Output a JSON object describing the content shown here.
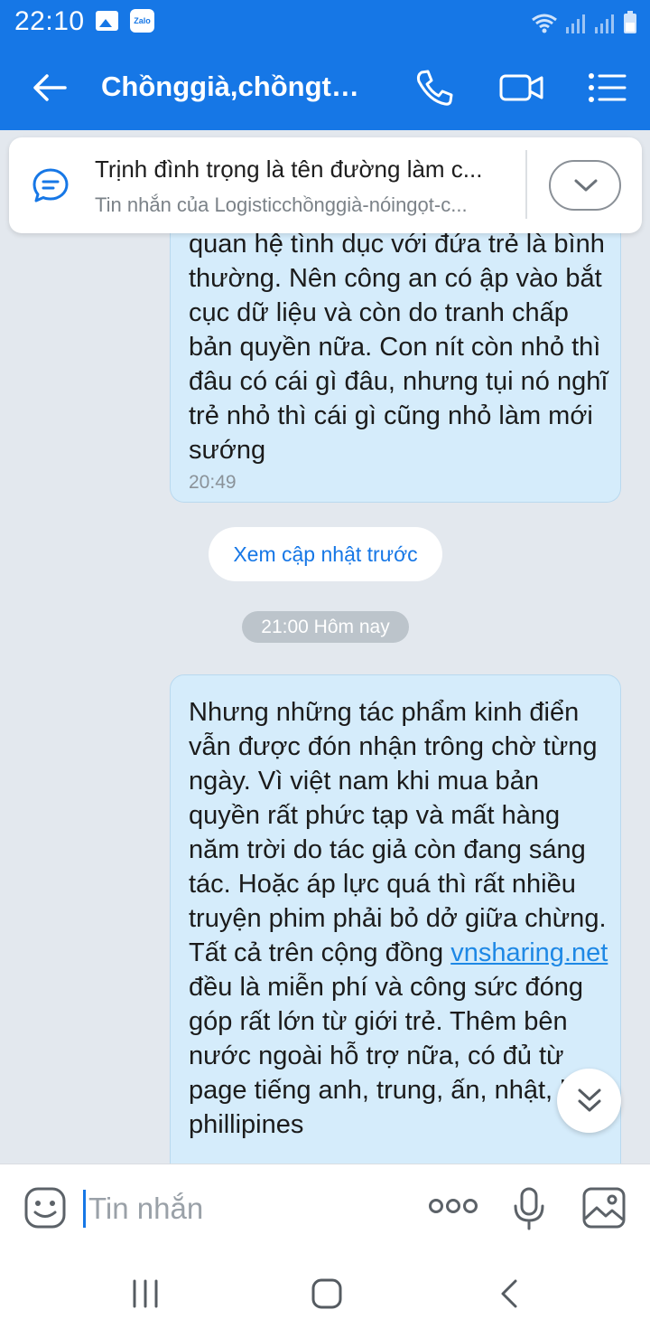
{
  "status_bar": {
    "time": "22:10",
    "notification_icons": [
      "gallery-icon",
      "zalo-icon"
    ],
    "system_icons": [
      "wifi-icon",
      "signal-icon",
      "signal-icon",
      "battery-icon"
    ],
    "zalo_label": "Zalo"
  },
  "header": {
    "title": "Chồnggià,chồngtr...",
    "actions": [
      "back-arrow-icon",
      "phone-icon",
      "video-call-icon",
      "menu-list-icon"
    ]
  },
  "pinned": {
    "title": "Trịnh đình trọng là tên đường làm c...",
    "subtitle": "Tin nhắn của Logisticchồnggià-nóingọt-c..."
  },
  "messages": [
    {
      "text": "quan hệ tình dục với đứa trẻ là bình thường. Nên công an có ập vào bắt cục dữ liệu và còn do tranh chấp bản quyền nữa. Con nít còn nhỏ thì đâu có cái gì đâu, nhưng tụi nó nghĩ trẻ nhỏ thì cái gì cũng nhỏ làm mới sướng",
      "time": "20:49"
    },
    {
      "text_before": "Nhưng những tác phẩm kinh điển vẫn được đón nhận trông chờ từng ngày. Vì việt nam khi mua bản quyền rất phức tạp và mất hàng năm trời do tác giả còn đang sáng tác. Hoặc áp lực quá thì rất nhiều truyện phim phải bỏ dở giữa chừng. Tất cả trên cộng đồng ",
      "link": "vnsharing.net",
      "text_after": " đều là miễn phí và công sức đóng góp rất lớn từ giới trẻ. Thêm bên nước ngoài hỗ trợ nữa, có đủ từ page tiếng anh, trung, ấn, nhật, hàn, phillipines"
    }
  ],
  "load_earlier_label": "Xem cập nhật trước",
  "date_divider": "21:00 Hôm nay",
  "input": {
    "placeholder": "Tin nhắn",
    "value": ""
  },
  "colors": {
    "brand_blue": "#1677e6",
    "bubble_bg": "#d5ecfb",
    "chat_bg": "#e3e8ee",
    "link": "#1e88e5"
  }
}
